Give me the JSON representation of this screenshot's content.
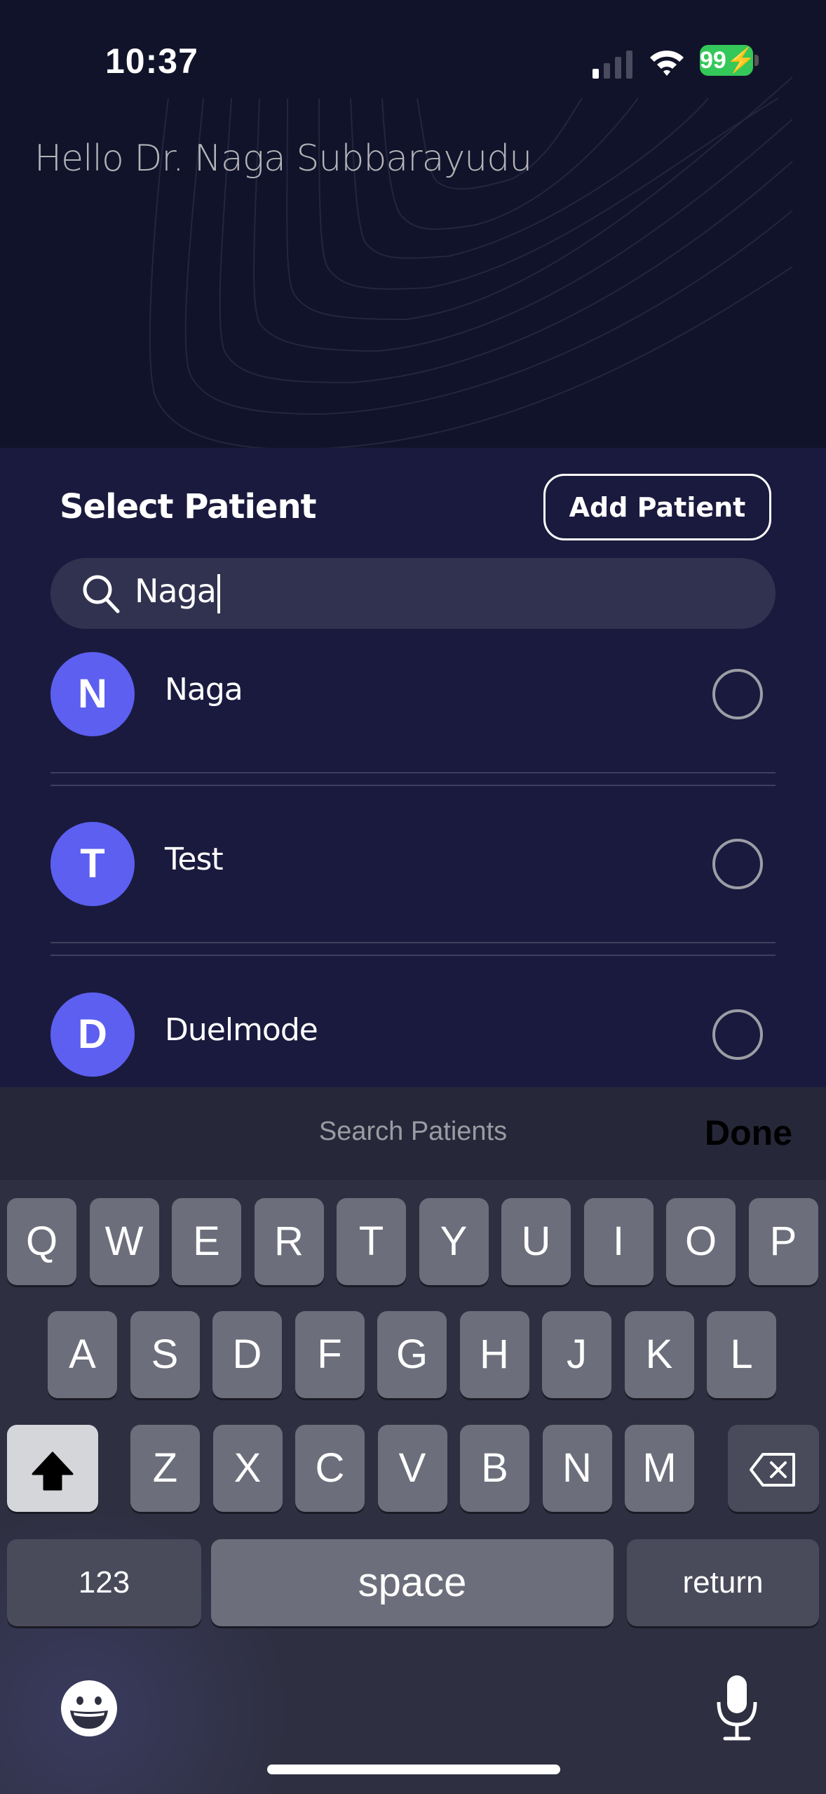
{
  "status_bar": {
    "time": "10:37",
    "battery": "99"
  },
  "header": {
    "greeting": "Hello Dr. Naga Subbarayudu"
  },
  "sheet": {
    "title": "Select Patient",
    "add_button": "Add Patient",
    "search": {
      "value": "Naga",
      "icon": "search-icon"
    },
    "patients": [
      {
        "initial": "N",
        "name": "Naga",
        "selected": false
      },
      {
        "initial": "T",
        "name": "Test",
        "selected": false
      },
      {
        "initial": "D",
        "name": "Duelmode",
        "selected": false
      }
    ],
    "avatar_color": "#5c5ff0"
  },
  "keyboard": {
    "accessory_placeholder": "Search Patients",
    "done": "Done",
    "rows": [
      [
        "Q",
        "W",
        "E",
        "R",
        "T",
        "Y",
        "U",
        "I",
        "O",
        "P"
      ],
      [
        "A",
        "S",
        "D",
        "F",
        "G",
        "H",
        "J",
        "K",
        "L"
      ],
      [
        "Z",
        "X",
        "C",
        "V",
        "B",
        "N",
        "M"
      ]
    ],
    "numbers": "123",
    "space": "space",
    "return": "return"
  }
}
